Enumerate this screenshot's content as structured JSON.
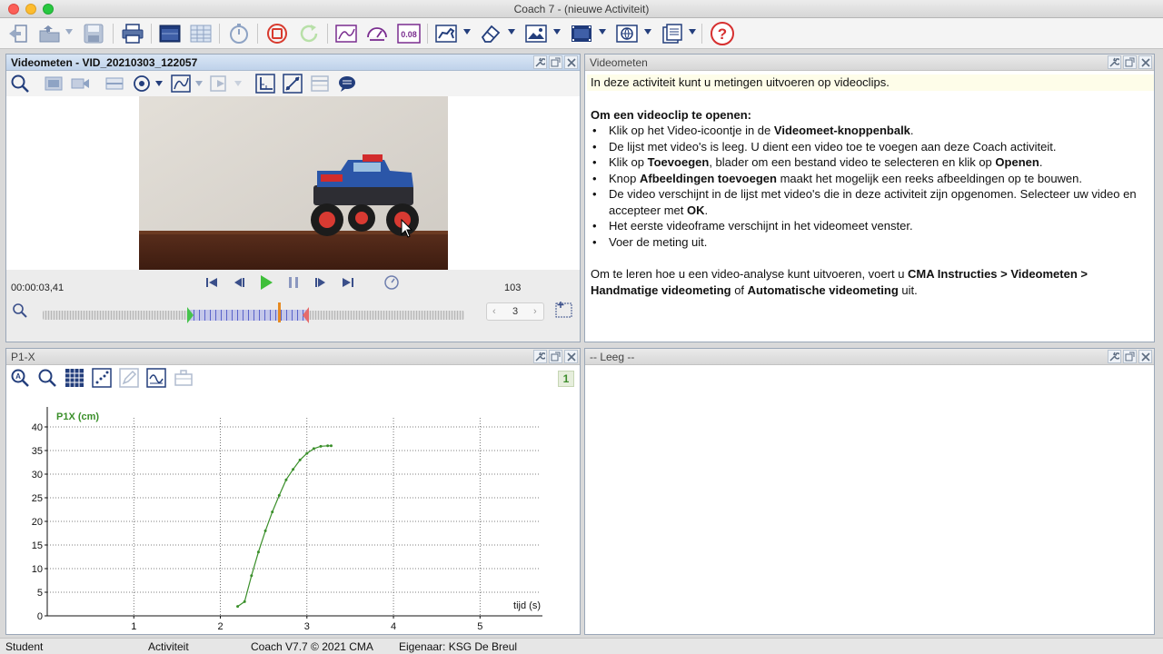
{
  "window": {
    "title": "Coach 7 - (nieuwe Activiteit)"
  },
  "toolbar": {
    "icons": [
      "back-icon",
      "open-folder-icon",
      "save-icon",
      "print-icon",
      "monitor-window-icon",
      "table-window-icon",
      "timer-icon",
      "stop-icon",
      "refresh-icon",
      "graph-icon",
      "gauge-icon",
      "value-display-icon",
      "animation-icon",
      "eraser-icon",
      "image-icon",
      "film-icon",
      "web-icon",
      "document-icon",
      "help-icon"
    ],
    "value_display_text": "0.08",
    "help_glyph": "?"
  },
  "video_panel": {
    "title": "Videometen - VID_20210303_122057",
    "timecode": "00:00:03,41",
    "frame_count": "103",
    "step_value": "3",
    "current_frame_fraction": 0.56
  },
  "text_panel": {
    "title": "Videometen",
    "intro": "In deze activiteit kunt u metingen uitvoeren op videoclips.",
    "heading": "Om een videoclip te openen:",
    "items": [
      {
        "a": "Klik op het Video-icoontje in de ",
        "b": "Videomeet-knoppenbalk",
        "c": ".",
        "d": "",
        "e": "",
        "f": ""
      },
      {
        "a": "De lijst met video's is leeg. U dient een video toe te voegen aan deze Coach activiteit.",
        "b": "",
        "c": "",
        "d": "",
        "e": "",
        "f": ""
      },
      {
        "a": "Klik op ",
        "b": "Toevoegen",
        "c": ", blader om een bestand video te selecteren en klik op ",
        "d": "Openen",
        "e": ".",
        "f": ""
      },
      {
        "a": "Knop ",
        "b": "Afbeeldingen toevoegen",
        "c": " maakt het mogelijk een reeks afbeeldingen op te bouwen.",
        "d": "",
        "e": "",
        "f": ""
      },
      {
        "a": "De video verschijnt in de lijst met video's die in deze activiteit zijn opgenomen. Selecteer uw video en accepteer met ",
        "b": "OK",
        "c": ".",
        "d": "",
        "e": "",
        "f": ""
      },
      {
        "a": "Het eerste videoframe verschijnt in het videomeet venster.",
        "b": "",
        "c": "",
        "d": "",
        "e": "",
        "f": ""
      },
      {
        "a": "Voer de meting uit.",
        "b": "",
        "c": "",
        "d": "",
        "e": "",
        "f": ""
      }
    ],
    "outro": {
      "a": "Om te leren hoe u een video-analyse kunt uitvoeren, voert u ",
      "b": "CMA Instructies > Videometen > Handmatige videometing",
      "c": " of ",
      "d": "Automatische videometing",
      "e": " uit."
    }
  },
  "graph_panel": {
    "title": "P1-X",
    "badge": "1"
  },
  "empty_panel": {
    "title": "-- Leeg --"
  },
  "chart_data": {
    "type": "line",
    "ylabel": "P1X (cm)",
    "xlabel": "tijd (s)",
    "xlim": [
      0,
      5.7
    ],
    "ylim": [
      0,
      40
    ],
    "x_ticks": [
      1,
      2,
      3,
      4,
      5
    ],
    "y_ticks": [
      0,
      5,
      10,
      15,
      20,
      25,
      30,
      35,
      40
    ],
    "grid": true,
    "line_color": "#3a8f2a",
    "series": [
      {
        "x": [
          2.2,
          2.28,
          2.36,
          2.44,
          2.52,
          2.6,
          2.68,
          2.76,
          2.84,
          2.92,
          3.0,
          3.08,
          3.16,
          3.24,
          3.28
        ],
        "y": [
          2.0,
          3.0,
          8.5,
          13.5,
          18.0,
          22.0,
          25.5,
          28.8,
          31.0,
          33.0,
          34.4,
          35.4,
          35.9,
          36.0,
          36.0
        ]
      }
    ]
  },
  "statusbar": {
    "user": "Student",
    "mode": "Activiteit",
    "version": "Coach V7.7 © 2021 CMA",
    "owner": "Eigenaar: KSG De Breul"
  }
}
